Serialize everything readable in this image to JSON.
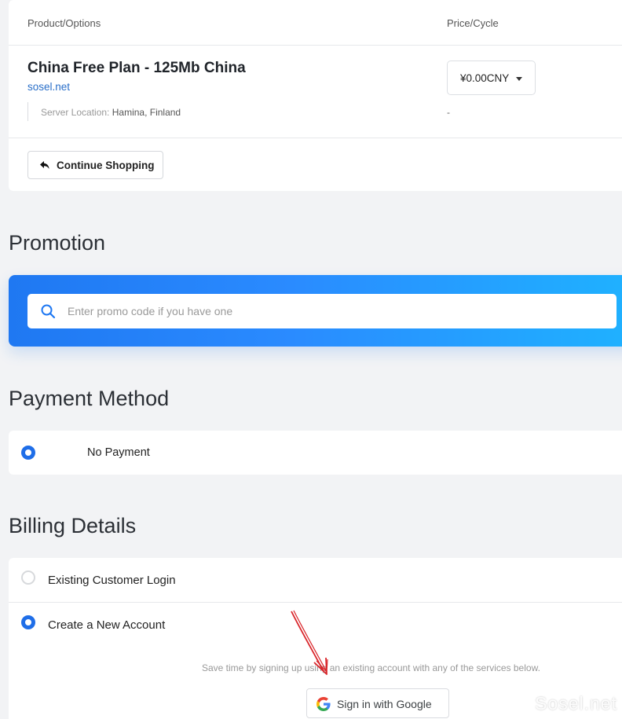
{
  "cart": {
    "col_product": "Product/Options",
    "col_price": "Price/Cycle",
    "product_title": "China Free Plan - 125Mb China",
    "product_domain": "sosel.net",
    "server_location_label": "Server Location:",
    "server_location_value": "Hamina, Finland",
    "price_value": "¥0.00CNY",
    "price_dash": "-",
    "continue_label": "Continue Shopping"
  },
  "promotion": {
    "title": "Promotion",
    "placeholder": "Enter promo code if you have one"
  },
  "payment": {
    "title": "Payment Method",
    "option_label": "No Payment",
    "option_selected": true
  },
  "billing": {
    "title": "Billing Details",
    "existing_label": "Existing Customer Login",
    "new_label": "Create a New Account",
    "save_time_text": "Save time by signing up using an existing account with any of the services below.",
    "google_label": "Sign in with Google"
  },
  "watermark": "Sosel.net",
  "colors": {
    "accent": "#1f6ee8",
    "link": "#2a6fc9",
    "annotation_arrow": "#d9262b"
  },
  "icons": {
    "continue": "back-arrow-icon",
    "promo": "search-icon",
    "google": "google-icon"
  }
}
